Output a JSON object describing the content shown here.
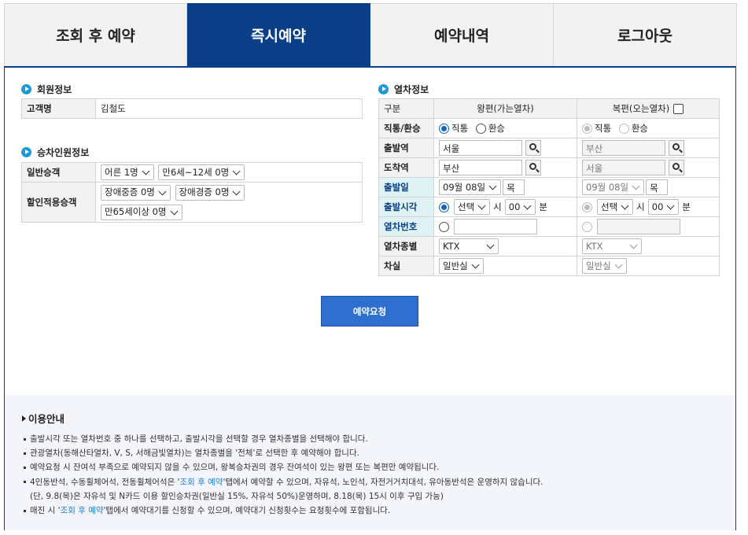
{
  "tabs": [
    "조회 후 예약",
    "즉시예약",
    "예약내역",
    "로그아웃"
  ],
  "member": {
    "title": "회원정보",
    "name_label": "고객명",
    "name_value": "김철도"
  },
  "passengers": {
    "title": "승차인원정보",
    "general_label": "일반승객",
    "adult": "어른 1명",
    "child": "만6세~12세 0명",
    "discount_label": "할인적용승객",
    "disabled_severe": "장애중증 0명",
    "disabled_mild": "장애경증 0명",
    "senior": "만65세이상 0명"
  },
  "train": {
    "title": "열차정보",
    "col_label": "구분",
    "col_out": "왕편(가는열차)",
    "col_ret": "복편(오는열차)",
    "rows": {
      "direct": "직통/환승",
      "dep_station": "출발역",
      "arr_station": "도착역",
      "dep_date": "출발일",
      "dep_time": "출발시각",
      "train_no": "열차번호",
      "train_type": "열차종별",
      "car_class": "차실"
    },
    "opt_direct": "직통",
    "opt_transfer": "환승",
    "out": {
      "dep": "서울",
      "arr": "부산",
      "date": "09월 08일",
      "day": "목",
      "hour": "선택",
      "minute": "00",
      "type": "KTX",
      "class": "일반실"
    },
    "ret": {
      "dep": "부산",
      "arr": "서울",
      "date": "09월 08일",
      "day": "목",
      "hour": "선택",
      "minute": "00",
      "type": "KTX",
      "class": "일반실"
    },
    "unit_hour": "시",
    "unit_min": "분"
  },
  "request_button": "예약요청",
  "guide": {
    "title": "이용안내",
    "l1": "출발시각 또는 열차번호 중 하나를 선택하고, 출발시각을 선택할 경우 열차종별을 선택해야 합니다.",
    "l2": "관광열차(동해산타열차, V, S, 서해금빛열차)는 열차종별을 '전체'로 선택한 후 예약해야 합니다.",
    "l3": "예약요청 시 잔여석 부족으로 예약되지 않을 수 있으며, 왕복승차권의 경우 잔여석이 있는 왕편 또는 복편만 예약됩니다.",
    "l4a": "4인동반석, 수동휠체어석, 전동휠체어석은 '",
    "l4link": "조회 후 예약",
    "l4b": "'탭에서 예약할 수 있으며, 자유석, 노인석, 자전거거치대석, 유아동반석은 운영하지 않습니다.",
    "l5": "(단, 9.8(목)은 자유석 및 N카드 이용 할인승차권(일반실 15%, 자유석 50%)운영하며, 8.18(목) 15시 이후 구입 가능)",
    "l6a": "매진 시 '",
    "l6link": "조회 후 예약",
    "l6b": "'탭에서 예약대기를 신청할 수 있으며, 예약대기 신청횟수는 요청횟수에 포함됩니다."
  }
}
